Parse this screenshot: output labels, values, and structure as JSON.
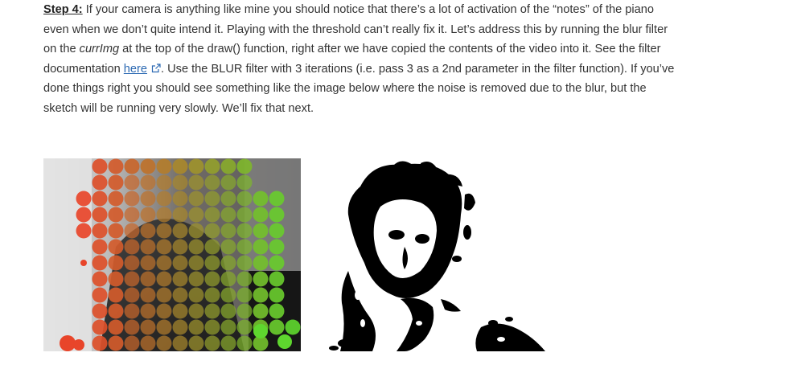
{
  "paragraph": {
    "step_label": "Step 4:",
    "text_1": " If your camera is anything like mine you should notice that there’s a lot of activation of the “notes” of the piano even when we don’t quite intend it. Playing with the threshold can’t really fix it. Let’s address this by running the blur filter on the ",
    "code_var": "currImg",
    "text_2": " at the top of the draw() function, right after we have copied the contents of the video into it. See the filter documentation ",
    "link_label": "here",
    "text_3": ". Use the BLUR filter with 3 iterations (i.e. pass 3 as a 2nd parameter in the filter function). If you’ve done things right you should see something like the image below where the noise is removed due to the blur, but the sketch will be running very slowly. We’ll fix that next."
  },
  "icons": {
    "external_link": "external-link-icon"
  },
  "colors": {
    "link": "#2d6ab3",
    "text": "#333333",
    "dot_red": "#e8452a",
    "dot_green": "#5ed62e"
  }
}
